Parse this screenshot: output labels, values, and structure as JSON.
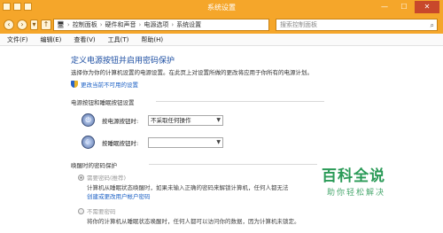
{
  "window": {
    "title": "系统设置",
    "minimize": "—",
    "maximize": "☐",
    "close": "✕"
  },
  "address": {
    "crumbs": [
      "控制面板",
      "硬件和声音",
      "电源选项",
      "系统设置"
    ],
    "search_placeholder": "搜索控制面板"
  },
  "menu": [
    "文件(F)",
    "编辑(E)",
    "查看(V)",
    "工具(T)",
    "帮助(H)"
  ],
  "main": {
    "heading": "定义电源按钮并启用密码保护",
    "description": "选择你为你的计算机设置的电源设置。在此页上对设置所做的更改将应用于你所有的电源计划。",
    "change_link": "更改当前不可用的设置",
    "power_section_title": "电源按钮和睡眠按钮设置",
    "power_button_label": "按电源按钮时:",
    "power_button_value": "不采取任何操作",
    "sleep_button_label": "按睡眠按钮时:",
    "sleep_button_value": "",
    "wake_section_title": "唤醒时的密码保护",
    "require_password_label": "需要密码(推荐)",
    "require_password_desc": "计算机从睡眠状态唤醒时，如果未输入正确的密码来解锁计算机，任何人都无法",
    "require_password_desc2": "创建或更改用户帐户密码",
    "no_password_label": "不需要密码",
    "no_password_desc": "将你的计算机从睡眠状态唤醒时，任何人都可以访问你的数据，因为计算机未锁定。"
  },
  "watermark": {
    "title": "百科全说",
    "subtitle": "助你轻松解决"
  }
}
